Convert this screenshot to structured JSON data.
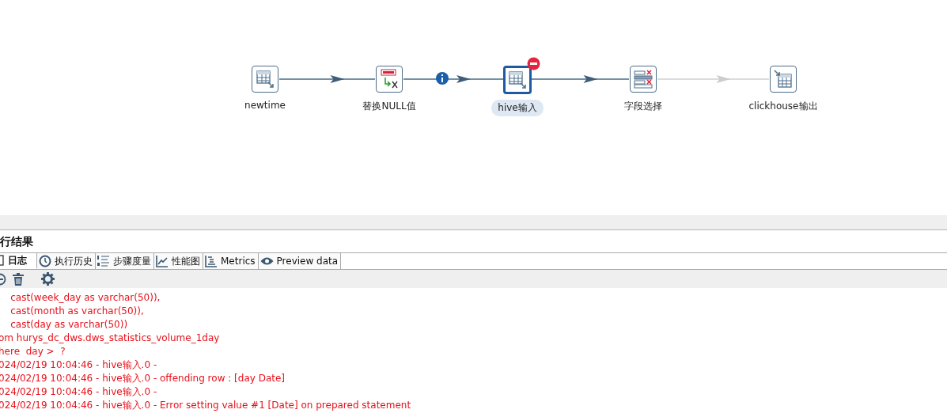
{
  "canvas": {
    "steps": [
      {
        "label": "newtime",
        "selected": false,
        "error": false
      },
      {
        "label": "替换NULL值",
        "selected": false,
        "error": false
      },
      {
        "label": "hive输入",
        "selected": true,
        "error": true
      },
      {
        "label": "字段选择",
        "selected": false,
        "error": false
      },
      {
        "label": "clickhouse输出",
        "selected": false,
        "error": false
      }
    ],
    "hops": [
      {
        "enabled": true,
        "info": false
      },
      {
        "enabled": true,
        "info": true
      },
      {
        "enabled": true,
        "info": false
      },
      {
        "enabled": false,
        "info": false
      }
    ]
  },
  "panel": {
    "title": "行结果",
    "tabs": [
      {
        "label": "日志",
        "selected": true
      },
      {
        "label": "执行历史",
        "selected": false
      },
      {
        "label": "步骤度量",
        "selected": false
      },
      {
        "label": "性能图",
        "selected": false
      },
      {
        "label": "Metrics",
        "selected": false
      },
      {
        "label": "Preview data",
        "selected": false
      }
    ],
    "log_lines": [
      {
        "text": "    cast(week_day as varchar(50)),",
        "error": true
      },
      {
        "text": "    cast(month as varchar(50)),",
        "error": true
      },
      {
        "text": "    cast(day as varchar(50))",
        "error": true
      },
      {
        "text": "om hurys_dc_dws.dws_statistics_volume_1day",
        "error": true
      },
      {
        "text": "here  day >  ?",
        "error": true
      },
      {
        "text": "024/02/19 10:04:46 - hive输入.0 -",
        "error": true
      },
      {
        "text": "024/02/19 10:04:46 - hive输入.0 - offending row : [day Date]",
        "error": true
      },
      {
        "text": "024/02/19 10:04:46 - hive输入.0 -",
        "error": true
      },
      {
        "text": "024/02/19 10:04:46 - hive输入.0 - Error setting value #1 [Date] on prepared statement",
        "error": true
      }
    ]
  }
}
